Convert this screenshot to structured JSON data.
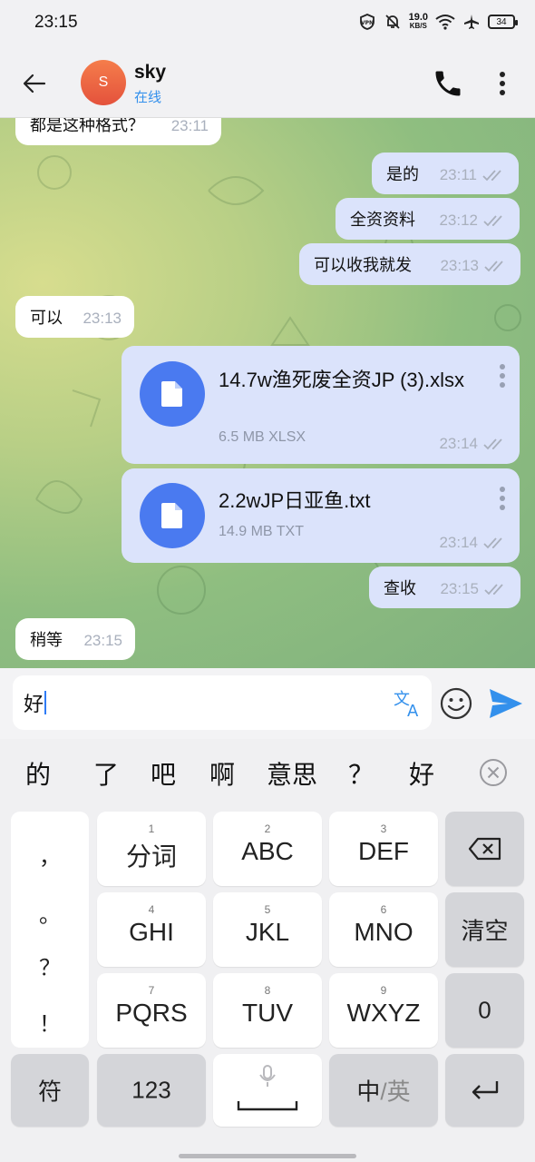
{
  "status_bar": {
    "time": "23:15",
    "vpn": "VPN",
    "net_speed": "19.0",
    "net_unit": "KB/S",
    "battery": "34"
  },
  "header": {
    "avatar_letter": "S",
    "contact_name": "sky",
    "contact_status": "在线"
  },
  "messages": [
    {
      "text": "都是这种格式？",
      "time": "23:11"
    },
    {
      "text": "是的",
      "time": "23:11"
    },
    {
      "text": "全资资料",
      "time": "23:12"
    },
    {
      "text": "可以收我就发",
      "time": "23:13"
    },
    {
      "text": "可以",
      "time": "23:13"
    },
    {
      "file_name": "14.7w渔死废全资JP (3).xlsx",
      "file_size": "6.5 MB XLSX",
      "time": "23:14"
    },
    {
      "file_name": "2.2wJP日亚鱼.txt",
      "file_size": "14.9 MB TXT",
      "time": "23:14"
    },
    {
      "text": "查收",
      "time": "23:15"
    },
    {
      "text": "稍等",
      "time": "23:15"
    }
  ],
  "input": {
    "value": "好"
  },
  "candidates": [
    "的",
    "了",
    "吧",
    "啊",
    "意思",
    "？",
    "好"
  ],
  "keyboard": {
    "punct": [
      "，",
      "。",
      "？",
      "！"
    ],
    "keys": [
      {
        "num": "1",
        "label": "分词"
      },
      {
        "num": "2",
        "label": "ABC"
      },
      {
        "num": "3",
        "label": "DEF"
      },
      {
        "num": "4",
        "label": "GHI"
      },
      {
        "num": "5",
        "label": "JKL"
      },
      {
        "num": "6",
        "label": "MNO"
      },
      {
        "num": "7",
        "label": "PQRS"
      },
      {
        "num": "8",
        "label": "TUV"
      },
      {
        "num": "9",
        "label": "WXYZ"
      }
    ],
    "clear": "清空",
    "zero": "0",
    "symbol": "符",
    "numbers": "123",
    "lang_a": "中",
    "lang_sep": "/",
    "lang_b": "英"
  },
  "colors": {
    "accent": "#3390ec",
    "outgoing_bubble": "#dbe3fb",
    "file_icon": "#4a7af0",
    "avatar": "#e8613f"
  }
}
